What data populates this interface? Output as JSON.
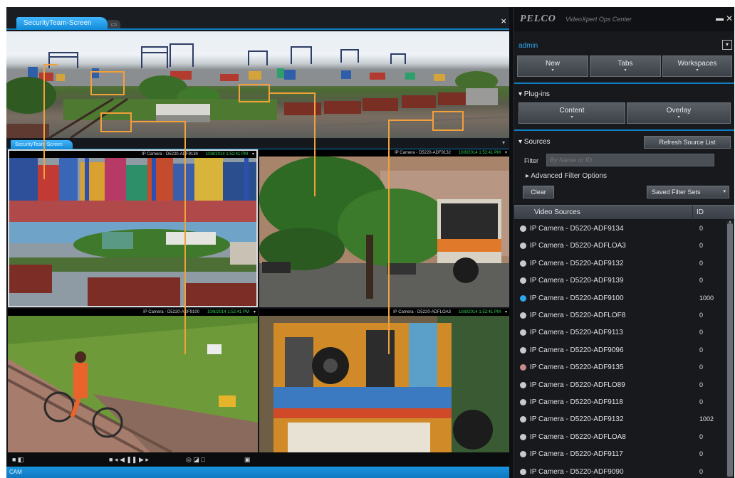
{
  "workspace": {
    "tab_label": "SecurityTeam-Screen",
    "close_glyph": "×",
    "sub_tab_label": "SecurityTeam-Screen",
    "sub_close_glyph": "▾",
    "status_left": "CAM",
    "toolbar": {
      "left": "■ ◧",
      "middle": "■ ◂ ◀ ❚❚ ▶ ▸",
      "right": "◎ ◪ □",
      "far": "▣"
    },
    "tiles": [
      {
        "camera": "IP Camera - D5220-ADF9134",
        "time": "10/8/2014 1:52:41 PM"
      },
      {
        "camera": "IP Camera - D5220-ADF9132",
        "time": "10/8/2014 1:52:41 PM"
      },
      {
        "camera": "IP Camera - D5220-ADF9100",
        "time": "10/8/2014 1:52:41 PM"
      },
      {
        "camera": "IP Camera - D5220-ADFLOA3",
        "time": "10/8/2014 1:52:41 PM"
      }
    ],
    "tile_menu_glyph": "▾"
  },
  "sidebar": {
    "brand": "PELCO",
    "product": "VideoXpert Ops Center",
    "minimize_glyph": "▬",
    "close_glyph": "✕",
    "user": "admin",
    "user_dd_glyph": "▾",
    "top_buttons": [
      "New",
      "Tabs",
      "Workspaces"
    ],
    "plugins_label": "▾ Plug-ins",
    "plugin_buttons": [
      "Content",
      "Overlay"
    ],
    "sources_label": "▾ Sources",
    "refresh_label": "Refresh Source List",
    "filter_label": "Filter",
    "filter_placeholder": "By Name or ID",
    "advanced_label": "▸ Advanced Filter Options",
    "clear_label": "Clear",
    "saved_filter_label": "Saved Filter Sets",
    "saved_dd_glyph": "▾",
    "col_video_sources": "Video Sources",
    "col_id": "ID",
    "scroll_up_glyph": "▴",
    "caret_glyph": "▾",
    "sources": [
      {
        "name": "IP Camera - D5220-ADF9134",
        "id": "0",
        "status": "#c7cacd"
      },
      {
        "name": "IP Camera - D5220-ADFLOA3",
        "id": "0",
        "status": "#c7cacd"
      },
      {
        "name": "IP Camera - D5220-ADF9132",
        "id": "0",
        "status": "#c7cacd"
      },
      {
        "name": "IP Camera - D5220-ADF9139",
        "id": "0",
        "status": "#c7cacd"
      },
      {
        "name": "IP Camera - D5220-ADF9100",
        "id": "1000",
        "status": "#2ea7ee"
      },
      {
        "name": "IP Camera - D5220-ADFLOF8",
        "id": "0",
        "status": "#c7cacd"
      },
      {
        "name": "IP Camera - D5220-ADF9113",
        "id": "0",
        "status": "#c7cacd"
      },
      {
        "name": "IP Camera - D5220-ADF9096",
        "id": "0",
        "status": "#c7cacd"
      },
      {
        "name": "IP Camera - D5220-ADF9135",
        "id": "0",
        "status": "#c98a8a"
      },
      {
        "name": "IP Camera - D5220-ADFLO89",
        "id": "0",
        "status": "#c7cacd"
      },
      {
        "name": "IP Camera - D5220-ADF9118",
        "id": "0",
        "status": "#c7cacd"
      },
      {
        "name": "IP Camera - D5220-ADF9132",
        "id": "1002",
        "status": "#c7cacd"
      },
      {
        "name": "IP Camera - D5220-ADFLOA8",
        "id": "0",
        "status": "#c7cacd"
      },
      {
        "name": "IP Camera - D5220-ADF9117",
        "id": "0",
        "status": "#c7cacd"
      },
      {
        "name": "IP Camera - D5220-ADF9090",
        "id": "0",
        "status": "#c7cacd"
      }
    ]
  },
  "colors": {
    "accent": "#0e7fc4",
    "callout": "#f2a03a",
    "timestamp": "#36d35a"
  }
}
